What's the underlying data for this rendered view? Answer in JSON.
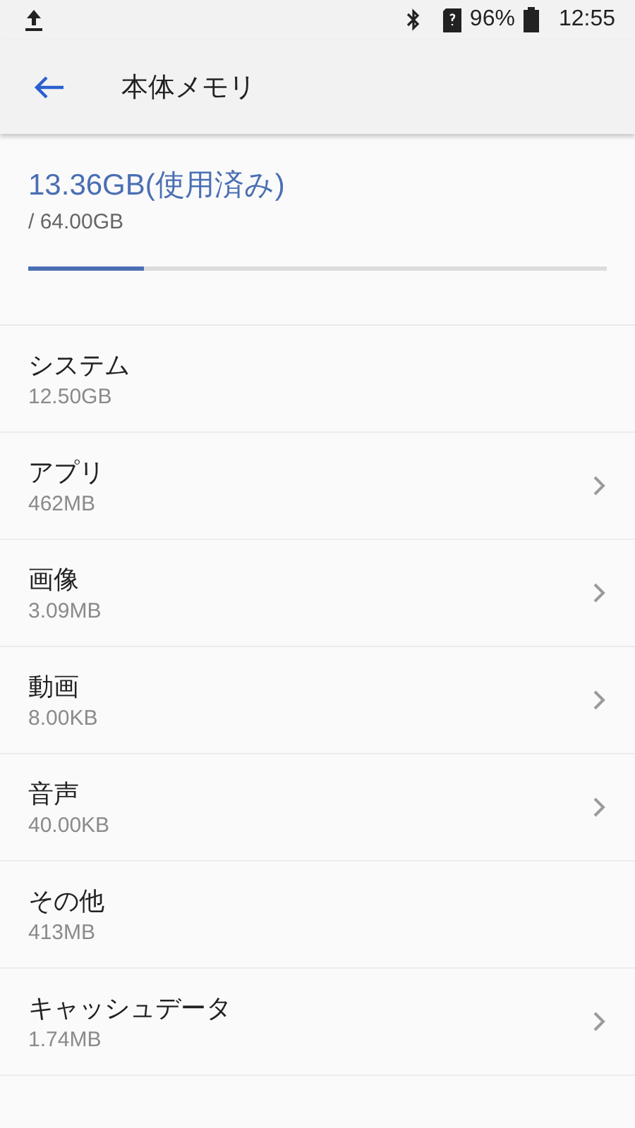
{
  "status_bar": {
    "battery": "96%",
    "time": "12:55"
  },
  "toolbar": {
    "title": "本体メモリ"
  },
  "summary": {
    "used": "13.36GB(使用済み)",
    "total": "/ 64.00GB",
    "level": 0.2
  },
  "items": [
    {
      "label": "システム",
      "size": "12.50GB",
      "chevron": false
    },
    {
      "label": "アプリ",
      "size": "462MB",
      "chevron": true
    },
    {
      "label": "画像",
      "size": "3.09MB",
      "chevron": true
    },
    {
      "label": "動画",
      "size": "8.00KB",
      "chevron": true
    },
    {
      "label": "音声",
      "size": "40.00KB",
      "chevron": true
    },
    {
      "label": "その他",
      "size": "413MB",
      "chevron": false
    },
    {
      "label": "キャッシュデータ",
      "size": "1.74MB",
      "chevron": true
    }
  ]
}
